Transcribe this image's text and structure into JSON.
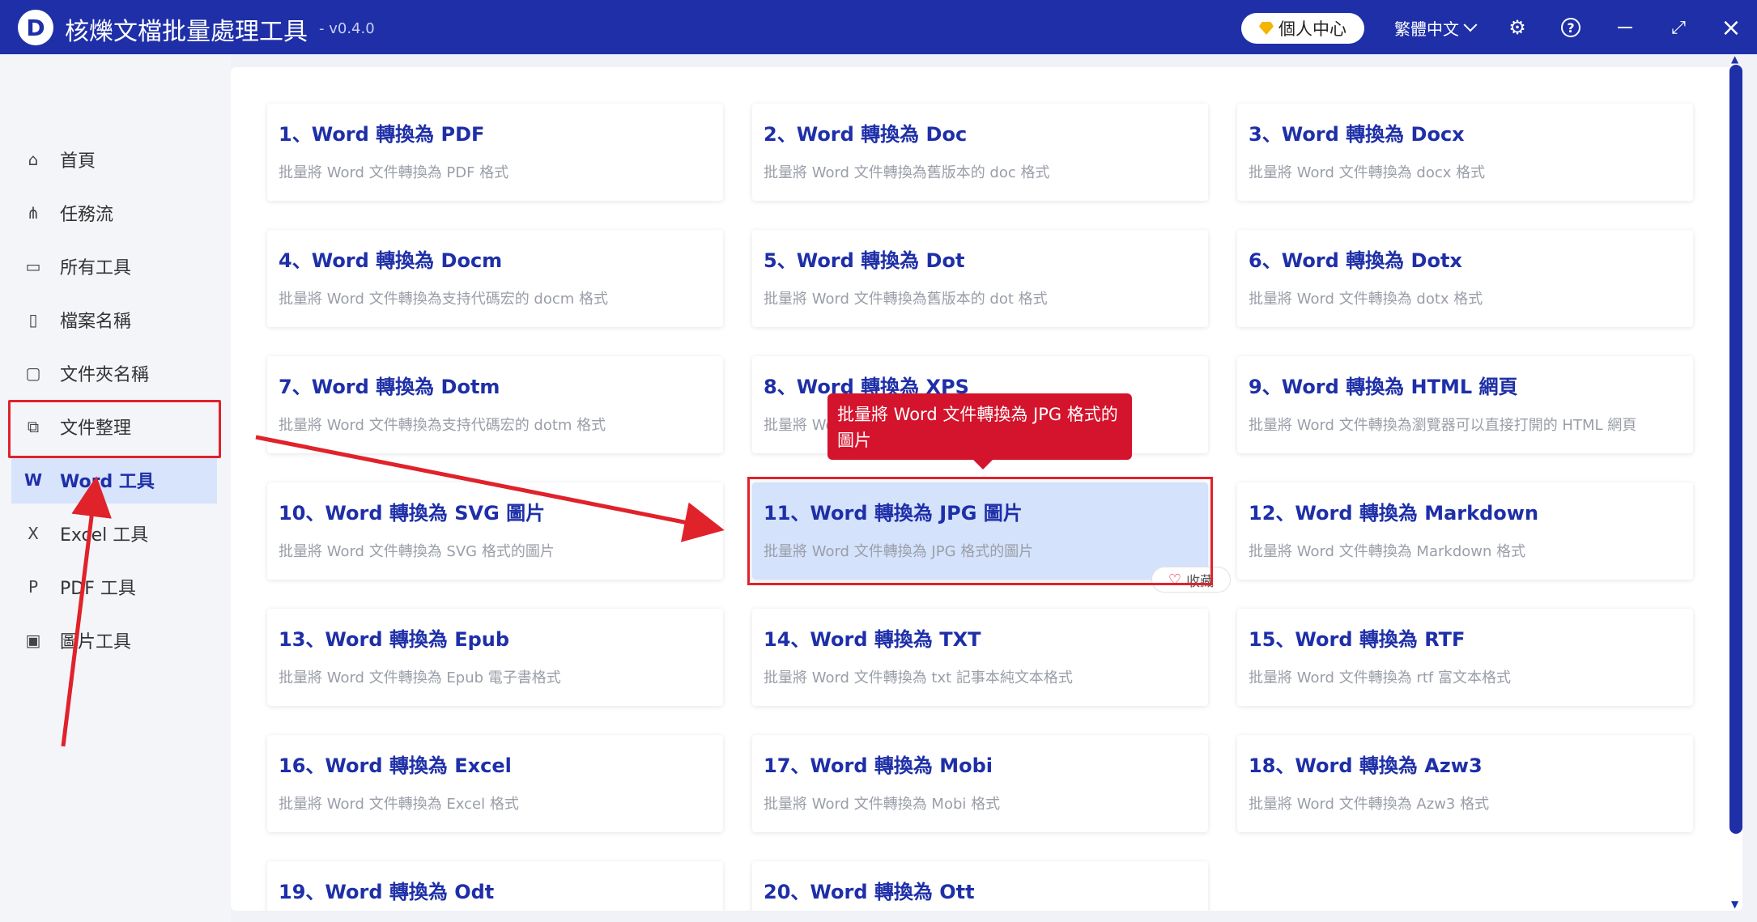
{
  "app": {
    "logo_letter": "D",
    "title": "核爍文檔批量處理工具",
    "version": "- v0.4.0",
    "profile_label": "個人中心",
    "language": "繁體中文"
  },
  "sidebar": {
    "items": [
      {
        "label": "首頁",
        "icon": "home-icon",
        "glyph": "⌂"
      },
      {
        "label": "任務流",
        "icon": "workflow-icon",
        "glyph": "⋔"
      },
      {
        "label": "所有工具",
        "icon": "monitor-icon",
        "glyph": "▭"
      },
      {
        "label": "檔案名稱",
        "icon": "file-icon",
        "glyph": "▯"
      },
      {
        "label": "文件夾名稱",
        "icon": "folder-icon",
        "glyph": "▢"
      },
      {
        "label": "文件整理",
        "icon": "organize-icon",
        "glyph": "⧉"
      },
      {
        "label": "Word 工具",
        "icon": "word-icon",
        "glyph": "W"
      },
      {
        "label": "Excel 工具",
        "icon": "excel-icon",
        "glyph": "X"
      },
      {
        "label": "PDF 工具",
        "icon": "pdf-icon",
        "glyph": "P"
      },
      {
        "label": "圖片工具",
        "icon": "image-icon",
        "glyph": "▣"
      }
    ],
    "active_index": 6
  },
  "tools": [
    {
      "title": "1、Word 轉換為 PDF",
      "desc": "批量將 Word 文件轉換為 PDF 格式"
    },
    {
      "title": "2、Word 轉換為 Doc",
      "desc": "批量將 Word 文件轉換為舊版本的 doc 格式"
    },
    {
      "title": "3、Word 轉換為 Docx",
      "desc": "批量將 Word 文件轉換為 docx 格式"
    },
    {
      "title": "4、Word 轉換為 Docm",
      "desc": "批量將 Word 文件轉換為支持代碼宏的 docm 格式"
    },
    {
      "title": "5、Word 轉換為 Dot",
      "desc": "批量將 Word 文件轉換為舊版本的 dot 格式"
    },
    {
      "title": "6、Word 轉換為 Dotx",
      "desc": "批量將 Word 文件轉換為 dotx 格式"
    },
    {
      "title": "7、Word 轉換為 Dotm",
      "desc": "批量將 Word 文件轉換為支持代碼宏的 dotm 格式"
    },
    {
      "title": "8、Word 轉換為 XPS",
      "desc": "批量將 Word 文件轉換為 XPS 格式"
    },
    {
      "title": "9、Word 轉換為 HTML 網頁",
      "desc": "批量將 Word 文件轉換為瀏覽器可以直接打開的 HTML 網頁"
    },
    {
      "title": "10、Word 轉換為 SVG 圖片",
      "desc": "批量將 Word 文件轉換為 SVG 格式的圖片"
    },
    {
      "title": "11、Word 轉換為 JPG 圖片",
      "desc": "批量將 Word 文件轉換為 JPG 格式的圖片"
    },
    {
      "title": "12、Word 轉換為 Markdown",
      "desc": "批量將 Word 文件轉換為 Markdown 格式"
    },
    {
      "title": "13、Word 轉換為 Epub",
      "desc": "批量將 Word 文件轉換為 Epub 電子書格式"
    },
    {
      "title": "14、Word 轉換為 TXT",
      "desc": "批量將 Word 文件轉換為 txt 記事本純文本格式"
    },
    {
      "title": "15、Word 轉換為 RTF",
      "desc": "批量將 Word 文件轉換為 rtf 富文本格式"
    },
    {
      "title": "16、Word 轉換為 Excel",
      "desc": "批量將 Word 文件轉換為 Excel 格式"
    },
    {
      "title": "17、Word 轉換為 Mobi",
      "desc": "批量將 Word 文件轉換為 Mobi 格式"
    },
    {
      "title": "18、Word 轉換為 Azw3",
      "desc": "批量將 Word 文件轉換為 Azw3 格式"
    },
    {
      "title": "19、Word 轉換為 Odt",
      "desc": ""
    },
    {
      "title": "20、Word 轉換為 Ott",
      "desc": ""
    }
  ],
  "selected_tool_index": 10,
  "favorite_label": "收藏",
  "tooltip": "批量將 Word 文件轉換為 JPG 格式的圖片",
  "colors": {
    "brand": "#1e2fa8",
    "highlight": "#e0222a",
    "tooltip": "#d4132c",
    "selected_card": "#d4e2fb"
  }
}
